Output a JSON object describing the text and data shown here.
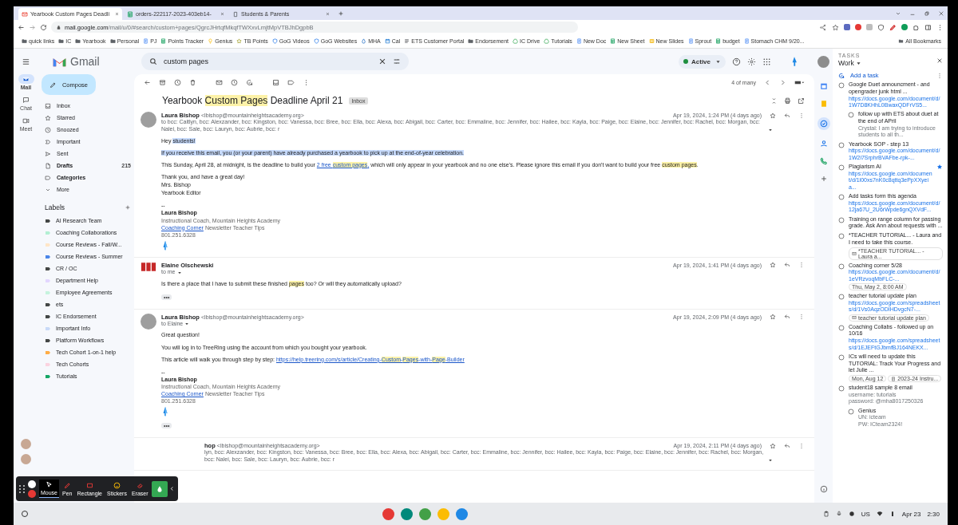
{
  "browser": {
    "tabs": [
      {
        "title": "Yearbook Custom Pages Deadli",
        "kind": "gmail",
        "selected": true
      },
      {
        "title": "orders-222117-2023-403eb14-",
        "kind": "sheet",
        "selected": false
      },
      {
        "title": "Students & Parents",
        "kind": "page",
        "selected": false
      }
    ],
    "url_host": "mail.google.com",
    "url_path": "/mail/u/0/#search/custom+pages/QgrcJHrtqfMkqfTWXxvLmjtMpVTBJhDgpbB",
    "bookmarks": [
      {
        "label": "quick links",
        "kind": "folder"
      },
      {
        "label": "IC",
        "kind": "folder"
      },
      {
        "label": "Yearbook",
        "kind": "folder"
      },
      {
        "label": "Personal",
        "kind": "folder"
      },
      {
        "label": "PJ",
        "kind": "doc"
      },
      {
        "label": "Points Tracker",
        "kind": "sheet"
      },
      {
        "label": "Genius",
        "kind": "bulb"
      },
      {
        "label": "TB Points",
        "kind": "star"
      },
      {
        "label": "GoG Videos",
        "kind": "shield"
      },
      {
        "label": "GoG Websites",
        "kind": "shield"
      },
      {
        "label": "MHA",
        "kind": "drop"
      },
      {
        "label": "Cal",
        "kind": "cal"
      },
      {
        "label": "ETS Customer Portal",
        "kind": "list"
      },
      {
        "label": "Endorsement",
        "kind": "folder"
      },
      {
        "label": "IC Drive",
        "kind": "drive"
      },
      {
        "label": "Tutorials",
        "kind": "drive"
      },
      {
        "label": "New Doc",
        "kind": "doc"
      },
      {
        "label": "New Sheet",
        "kind": "sheet"
      },
      {
        "label": "New Slides",
        "kind": "slides"
      },
      {
        "label": "Sprout",
        "kind": "doc"
      },
      {
        "label": "budget",
        "kind": "sheet"
      },
      {
        "label": "Stomach CHM 9/20...",
        "kind": "doc"
      }
    ],
    "all_bookmarks": "All Bookmarks"
  },
  "gmail": {
    "logo": "Gmail",
    "search": "custom pages",
    "status": "Active",
    "rail": [
      {
        "label": "Mail",
        "kind": "mail",
        "selected": true
      },
      {
        "label": "Chat",
        "kind": "chat",
        "selected": false
      },
      {
        "label": "Meet",
        "kind": "video",
        "selected": false
      }
    ],
    "compose": "Compose",
    "nav": [
      {
        "label": "Inbox",
        "kind": "inbox",
        "bold": false
      },
      {
        "label": "Starred",
        "kind": "star",
        "bold": false
      },
      {
        "label": "Snoozed",
        "kind": "clock",
        "bold": false
      },
      {
        "label": "Important",
        "kind": "important",
        "bold": false
      },
      {
        "label": "Sent",
        "kind": "send",
        "bold": false
      },
      {
        "label": "Drafts",
        "kind": "file",
        "bold": true,
        "count": "215"
      },
      {
        "label": "Categories",
        "kind": "label",
        "bold": true
      },
      {
        "label": "More",
        "kind": "down",
        "bold": false
      }
    ],
    "labels_title": "Labels",
    "labels": [
      {
        "name": "AI Research Team",
        "color": "#444746"
      },
      {
        "name": "Coaching Collaborations",
        "color": "#b3efd3"
      },
      {
        "name": "Course Reviews - Fall/W...",
        "color": "#ffe6c7"
      },
      {
        "name": "Course Reviews - Summer",
        "color": "#4a86e8"
      },
      {
        "name": "CR / OC",
        "color": "#444746"
      },
      {
        "name": "Department Help",
        "color": "#e3d7ff"
      },
      {
        "name": "Employee Agreements",
        "color": "#c6f3de"
      },
      {
        "name": "ets",
        "color": "#444746"
      },
      {
        "name": "IC Endorsement",
        "color": "#444746"
      },
      {
        "name": "Important Info",
        "color": "#c9daf8"
      },
      {
        "name": "Platform Workflows",
        "color": "#444746"
      },
      {
        "name": "Tech Cohort 1-on-1 help",
        "color": "#ffad47"
      },
      {
        "name": "Tech Cohorts",
        "color": "#fbd3e0"
      },
      {
        "name": "Tutorials",
        "color": "#16a766"
      }
    ],
    "pager": "4 of many",
    "subject": [
      {
        "text": "Yearbook ",
        "kind": "plain"
      },
      {
        "text": "Custom Pages",
        "kind": "match"
      },
      {
        "text": " Deadline April 21",
        "kind": "plain"
      }
    ],
    "subject_chip": "Inbox",
    "messages": [
      {
        "kind": "photo",
        "sender": "Laura Bishop",
        "email": "<lbishop@mountainheightsacademy.org>",
        "date": "Apr 19, 2024, 1:24 PM (4 days ago)",
        "starred": false,
        "to": "to bcc: Caitlyn, bcc: Alexzander, bcc: Kingston, bcc: Vanessa, bcc: Bree, bcc: Ella, bcc: Alexa, bcc: Abigail, bcc: Carter, bcc: Emmaline, bcc: Jennifer, bcc: Hailee, bcc: Kayla, bcc: Paige, bcc: Elaine, bcc: Jennifer, bcc: Rachel, bcc: Morgan, bcc: Nalei, bcc: Sale, bcc: Lauryn, bcc: Aubrie, bcc: r",
        "blocks": [
          [
            [
              {
                "text": "Hey ",
                "kind": "plain"
              },
              {
                "text": "students!",
                "kind": "selected"
              }
            ]
          ],
          [
            [
              {
                "text": "If you receive this email, you (or your parent) have already purchased a yearbook to pick up at the end-of-year celebration.",
                "kind": "selected"
              }
            ]
          ],
          [
            [
              {
                "text": "This Sunday, April 28, at midnight, is the deadline to build your ",
                "kind": "plain"
              },
              {
                "text": "2 free ",
                "kind": "link"
              },
              {
                "text": "custom pages",
                "kind": "link_match"
              },
              {
                "text": ",",
                "kind": "link"
              },
              {
                "text": " which will only appear in your yearbook and no one else's. Please ignore this email if you don't want to build your free ",
                "kind": "plain"
              },
              {
                "text": "custom pages",
                "kind": "match"
              },
              {
                "text": ".",
                "kind": "plain"
              }
            ]
          ],
          [
            [
              {
                "text": "Thank you, and have a great day!",
                "kind": "plain"
              }
            ],
            [
              {
                "text": "Mrs. Bishop",
                "kind": "plain"
              }
            ],
            [
              {
                "text": "Yearbook Editor",
                "kind": "plain"
              }
            ]
          ]
        ],
        "signature": {
          "dash": "--",
          "name": "Laura Bishop",
          "title": "Instructional Coach, Mountain Heights Academy",
          "link": "Coaching Corner",
          "rest": "Newsletter Teacher Tips",
          "phone": "801.251.6328"
        }
      },
      {
        "kind": "logo",
        "sender": "Elaine Olschewski",
        "date": "Apr 19, 2024, 1:41 PM (4 days ago)",
        "to": "to me",
        "starred": false,
        "blocks": [
          [
            [
              {
                "text": "Is there a place that I have to submit these finished ",
                "kind": "plain"
              },
              {
                "text": "pages",
                "kind": "match"
              },
              {
                "text": " too? Or will they automatically upload?",
                "kind": "plain"
              }
            ]
          ]
        ],
        "more": "•••"
      },
      {
        "kind": "photo",
        "sender": "Laura Bishop",
        "email": "<lbishop@mountainheightsacademy.org>",
        "date": "Apr 19, 2024, 2:09 PM (4 days ago)",
        "to": "to Elaine",
        "starred": false,
        "blocks": [
          [
            [
              {
                "text": "Great question!",
                "kind": "plain"
              }
            ]
          ],
          [
            [
              {
                "text": "You will log in to TreeRing using the account from which you bought your yearbook.",
                "kind": "plain"
              }
            ]
          ],
          [
            [
              {
                "text": "This article will walk you through step by step: ",
                "kind": "plain"
              },
              {
                "text": "https://help.treering.com/s/article/Creating-",
                "kind": "link"
              },
              {
                "text": "Custom",
                "kind": "link_match"
              },
              {
                "text": "-",
                "kind": "link"
              },
              {
                "text": "Pages",
                "kind": "link_match"
              },
              {
                "text": "-with-",
                "kind": "link"
              },
              {
                "text": "Page",
                "kind": "link_match"
              },
              {
                "text": "-Builder",
                "kind": "link"
              }
            ]
          ]
        ],
        "signature": {
          "dash": "--",
          "name": "Laura Bishop",
          "title": "Instructional Coach, Mountain Heights Academy",
          "link": "Coaching Corner",
          "rest": "Newsletter Teacher Tips",
          "phone": "801.251.6328"
        },
        "more": "•••"
      },
      {
        "kind": "covered",
        "sender": "hop",
        "email": "<lbishop@mountainheightsacademy.org>",
        "date": "Apr 19, 2024, 2:11 PM (4 days ago)",
        "starred": false,
        "to": "lyn, bcc: Alexzander, bcc: Kingston, bcc: Vanessa, bcc: Bree, bcc: Ella, bcc: Alexa, bcc: Abigail, bcc: Carter, bcc: Emmaline, bcc: Jennifer, bcc: Hailee, bcc: Kayla, bcc: Paige, bcc: Elaine, bcc: Jennifer, bcc: Rachel, bcc: Morgan, bcc: Nalei, bcc: Sale, bcc: Lauryn, bcc: Aubrie, bcc: r"
      }
    ]
  },
  "tasks": {
    "heading": "TASKS",
    "list": "Work",
    "add": "Add a task",
    "items": [
      {
        "title": "Google Duet announcment - and opengrader junk html ...",
        "link": "https://docs.google.com/document/d/1W7D8KHhL0BwaxQDFrVS5...",
        "done": false,
        "starred": false,
        "children": [
          {
            "title": "follow up with ETS about duet at the end of APril",
            "notes": "Crystal: I am trying to introduce students to all th...",
            "done": false,
            "starred": false
          }
        ]
      },
      {
        "title": "Yearbook SOP - step 13",
        "link": "https://docs.google.com/document/d/1W2i7SrphrBVAFbe-rpk-...",
        "done": false,
        "starred": false
      },
      {
        "title": "Plagiarism AI",
        "link": "https://docs.google.com/document/d/1l00xs7nK0c8qttq3ePpXXyeia...",
        "done": false,
        "starred": true
      },
      {
        "title": "Add tasks form this agenda",
        "link": "https://docs.google.com/document/d/12ja67U_2U6rWpde6gnQXVdF...",
        "done": false,
        "starred": false
      },
      {
        "title": "Training on range column for passing grade. Ask Ann about requests with ...",
        "done": false,
        "starred": false
      },
      {
        "title": "*TEACHER TUTORIAL... - Laura and I need to take this course.",
        "done": false,
        "starred": false,
        "chips": [
          {
            "kind": "email",
            "text": "*TEACHER TUTORIAL... - Laura a..."
          }
        ]
      },
      {
        "title": "Coaching corner 5/28",
        "link": "https://docs.google.com/document/d/1eVRzvoqMbFLC-...",
        "done": false,
        "starred": false,
        "chips": [
          {
            "kind": "date",
            "text": "Thu, May 2, 8:00 AM"
          }
        ]
      },
      {
        "title": "teacher tutorial update plan",
        "link": "https://docs.google.com/spreadsheets/d/1Vs0AqzODIHDvgcN7-...",
        "done": false,
        "starred": false,
        "chips": [
          {
            "kind": "email",
            "text": "teacher tutorial update plan"
          }
        ]
      },
      {
        "title": "Coaching Collabs - followed up on 10/16",
        "link": "https://docs.google.com/spreadsheets/d/1EJEFtGJbmfBJ164NEKX...",
        "done": false,
        "starred": false
      },
      {
        "title": "ICs will need to update this TUTORIAL: Track Your Progress and let Julie ...",
        "done": false,
        "starred": false,
        "chips": [
          {
            "kind": "date",
            "text": "Mon, Aug 12"
          },
          {
            "kind": "doc",
            "text": "2023-24 Instru..."
          }
        ]
      },
      {
        "title": "student18 sample 8 email",
        "notes": "username: tutorials\npassword: @mha8017250326",
        "done": false,
        "starred": false,
        "children": [
          {
            "title": "Genius",
            "notes": "UN: icteam\nPW: ICteam2324!",
            "done": false,
            "starred": false
          }
        ]
      }
    ]
  },
  "recorder": {
    "tools": [
      {
        "label": "Mouse",
        "kind": "cursor",
        "selected": true
      },
      {
        "label": "Pen",
        "kind": "pen",
        "selected": false
      },
      {
        "label": "Rectangle",
        "kind": "rect",
        "selected": false
      },
      {
        "label": "Stickers",
        "kind": "smile",
        "selected": false
      },
      {
        "label": "Eraser",
        "kind": "eraser",
        "selected": false
      }
    ]
  },
  "shelf": {
    "apps": [
      {
        "color": "#e53935"
      },
      {
        "color": "#00897b"
      },
      {
        "color": "#43a047"
      },
      {
        "color": "#fbbc04"
      },
      {
        "color": "#1e88e5"
      }
    ],
    "ime": "US",
    "date": "Apr 23",
    "time": "2:30"
  }
}
